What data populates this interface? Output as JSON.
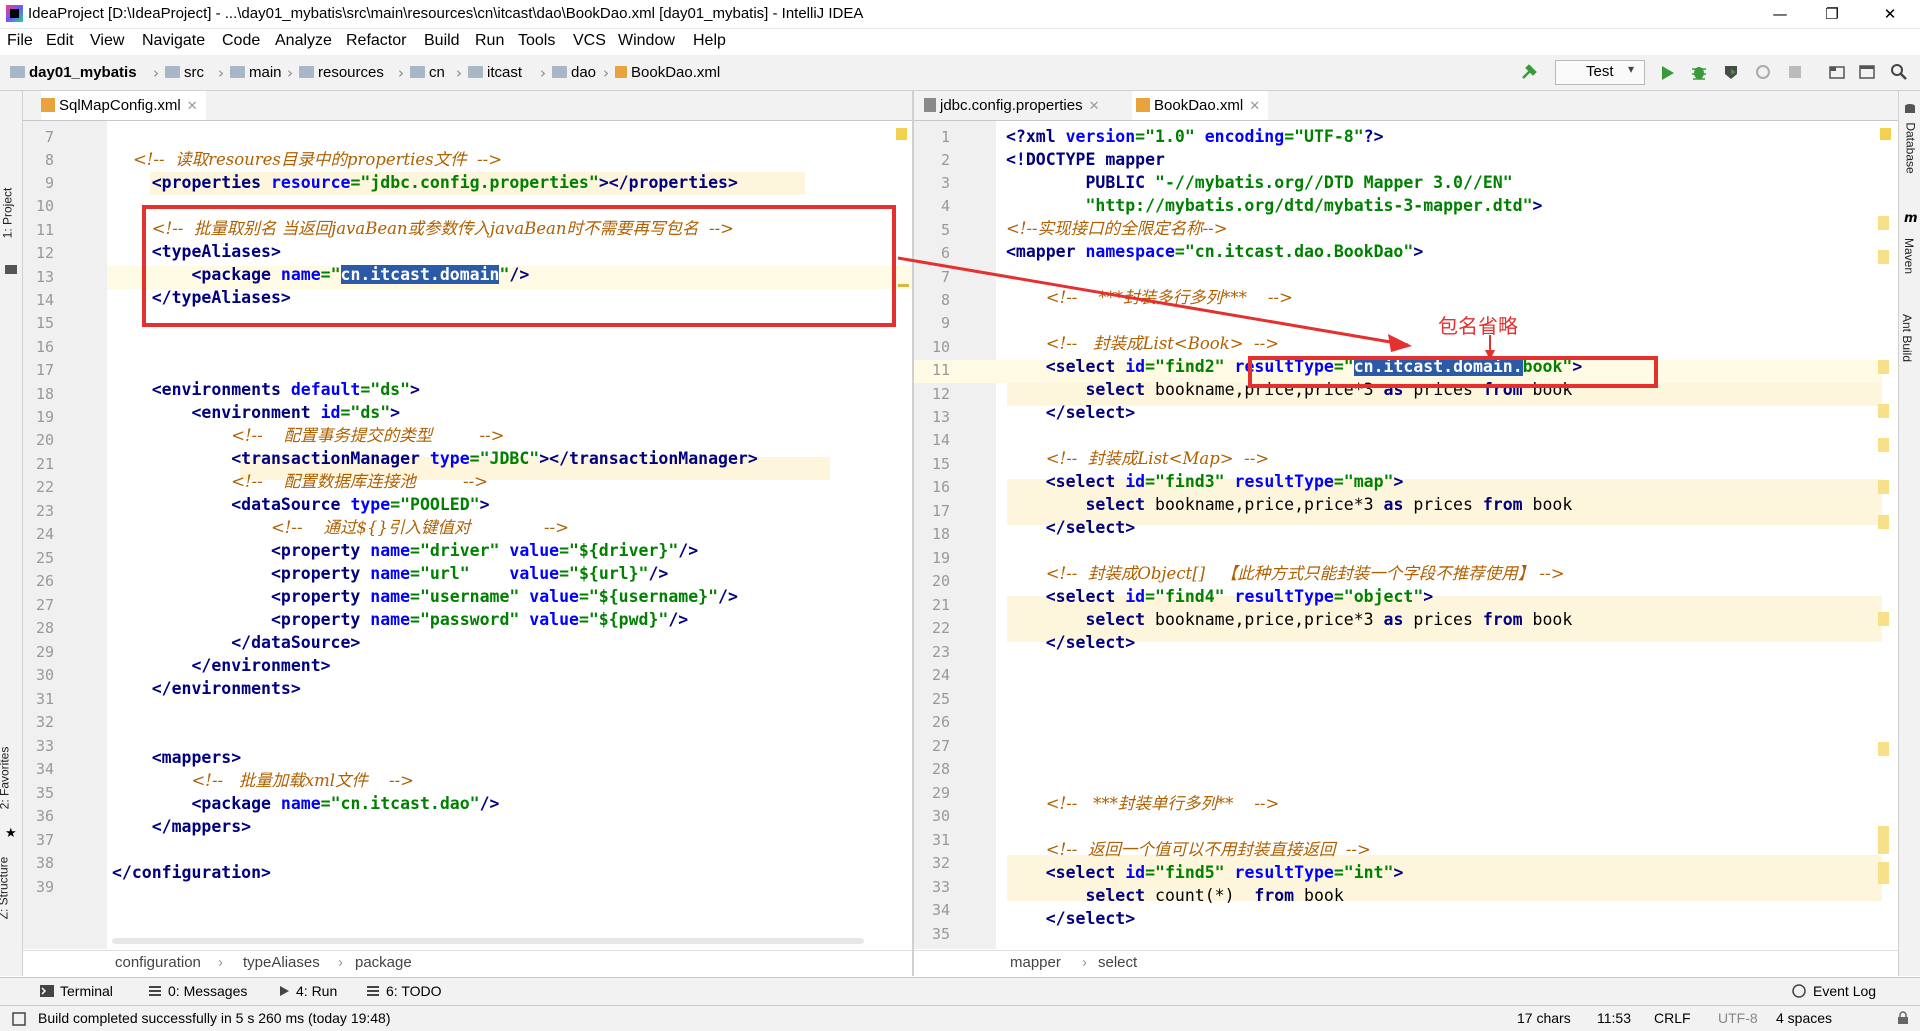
{
  "window": {
    "title": "IdeaProject [D:\\IdeaProject] - ...\\day01_mybatis\\src\\main\\resources\\cn\\itcast\\dao\\BookDao.xml [day01_mybatis] - IntelliJ IDEA",
    "minimize": "—",
    "maximize": "❐",
    "close": "✕"
  },
  "menu": [
    "File",
    "Edit",
    "View",
    "Navigate",
    "Code",
    "Analyze",
    "Refactor",
    "Build",
    "Run",
    "Tools",
    "VCS",
    "Window",
    "Help"
  ],
  "breadcrumb": [
    "day01_mybatis",
    "src",
    "main",
    "resources",
    "cn",
    "itcast",
    "dao",
    "BookDao.xml"
  ],
  "run_config": "Test",
  "left_tool_tabs": {
    "project": "1: Project",
    "favorites": "2: Favorites",
    "structure": "Z: Structure"
  },
  "right_tool_tabs": {
    "database": "Database",
    "maven": "Maven",
    "ant": "Ant Build"
  },
  "left_editor": {
    "tab": "SqlMapConfig.xml",
    "line_numbers": [
      "7",
      "8",
      "9",
      "10",
      "11",
      "12",
      "13",
      "14",
      "15",
      "16",
      "17",
      "18",
      "19",
      "20",
      "21",
      "22",
      "23",
      "24",
      "25",
      "26",
      "27",
      "28",
      "29",
      "30",
      "31",
      "32",
      "33",
      "34",
      "35",
      "36",
      "37",
      "38",
      "39"
    ],
    "breadcrumb": [
      "configuration",
      "typeAliases",
      "package"
    ]
  },
  "right_editor": {
    "tabs": [
      "jdbc.config.properties",
      "BookDao.xml"
    ],
    "line_numbers": [
      "1",
      "2",
      "3",
      "4",
      "5",
      "6",
      "7",
      "8",
      "9",
      "10",
      "11",
      "12",
      "13",
      "14",
      "15",
      "16",
      "17",
      "18",
      "19",
      "20",
      "21",
      "22",
      "23",
      "24",
      "25",
      "26",
      "27",
      "28",
      "29",
      "30",
      "31",
      "32",
      "33",
      "34",
      "35"
    ],
    "breadcrumb": [
      "mapper",
      "select"
    ]
  },
  "annotation": {
    "label": "包名省略"
  },
  "tool_windows": {
    "terminal": "Terminal",
    "messages": "0: Messages",
    "run": "4: Run",
    "todo": "6: TODO",
    "event_log": "Event Log"
  },
  "status": {
    "message": "Build completed successfully in 5 s 260 ms (today 19:48)",
    "chars": "17 chars",
    "position": "11:53",
    "line_sep": "CRLF",
    "encoding": "UTF-8",
    "indent": "4 spaces"
  },
  "colors": {
    "red_box": "#e53030",
    "selection": "#2a5aa8",
    "tag": "#000080",
    "attribute": "#0000ff",
    "value": "#008000",
    "comment": "#b06000"
  }
}
